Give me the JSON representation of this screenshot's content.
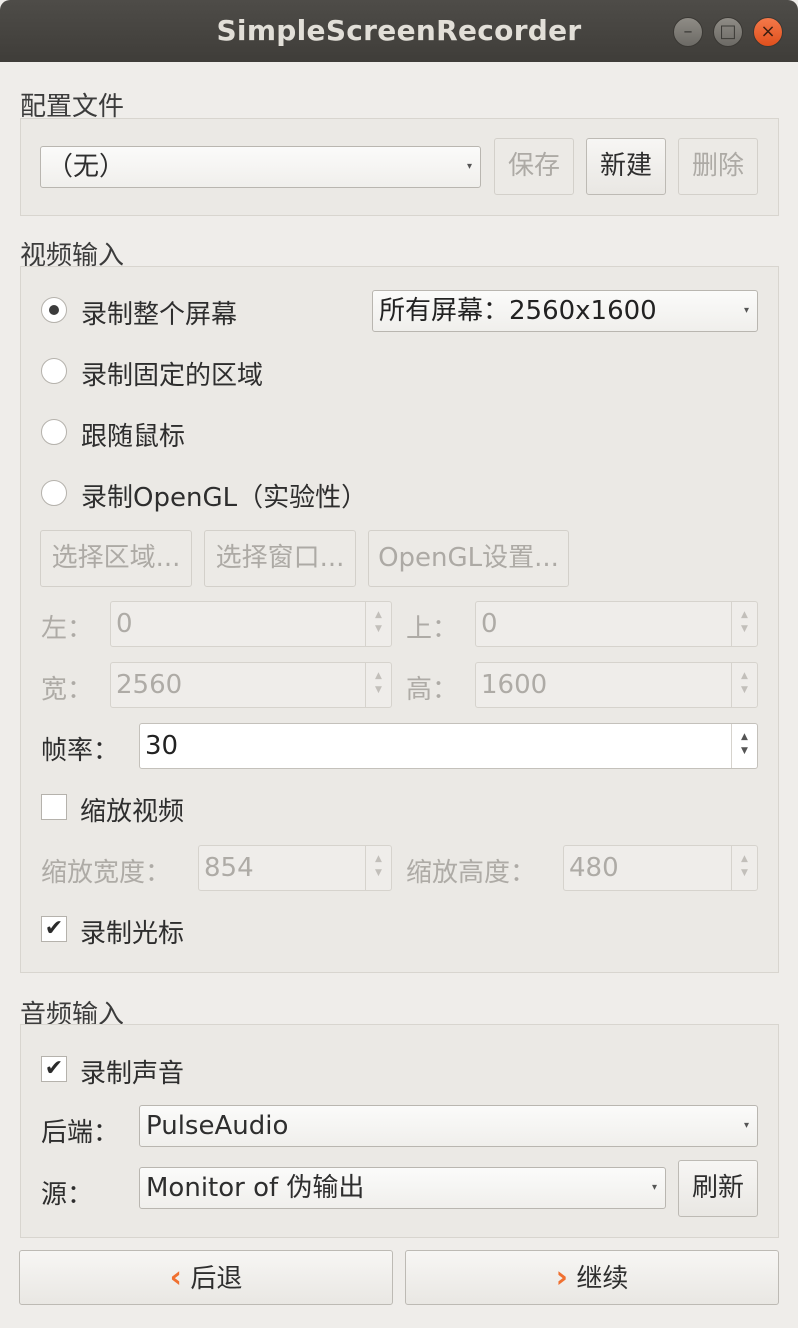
{
  "window": {
    "title": "SimpleScreenRecorder",
    "controls": {
      "minimize": "–",
      "maximize": "□",
      "close": "×"
    }
  },
  "profile": {
    "title": "配置文件",
    "selected": "（无）",
    "save": "保存",
    "new": "新建",
    "delete": "删除"
  },
  "video": {
    "title": "视频输入",
    "options": [
      "录制整个屏幕",
      "录制固定的区域",
      "跟随鼠标",
      "录制OpenGL（实验性）"
    ],
    "selected_option": 0,
    "screen_select": "所有屏幕：2560x1600",
    "select_area": "选择区域...",
    "select_window": "选择窗口...",
    "opengl_settings": "OpenGL设置...",
    "left_label": "左：",
    "left_value": "0",
    "top_label": "上：",
    "top_value": "0",
    "width_label": "宽：",
    "width_value": "2560",
    "height_label": "高：",
    "height_value": "1600",
    "fps_label": "帧率：",
    "fps_value": "30",
    "scale_video": "缩放视频",
    "scale_video_checked": false,
    "scale_width_label": "缩放宽度：",
    "scale_width_value": "854",
    "scale_height_label": "缩放高度：",
    "scale_height_value": "480",
    "record_cursor": "录制光标",
    "record_cursor_checked": true
  },
  "audio": {
    "title": "音频输入",
    "record_audio": "录制声音",
    "record_audio_checked": true,
    "backend_label": "后端：",
    "backend_value": "PulseAudio",
    "source_label": "源：",
    "source_value": "Monitor of 伪输出",
    "refresh": "刷新"
  },
  "nav": {
    "back": "后退",
    "continue": "继续"
  },
  "colors": {
    "titlebar": "#45433f",
    "close_button": "#e95420",
    "nav_chevron": "#f07030",
    "background": "#efedea"
  },
  "icons": {
    "back": "chevron-left-icon",
    "continue": "chevron-right-icon"
  }
}
